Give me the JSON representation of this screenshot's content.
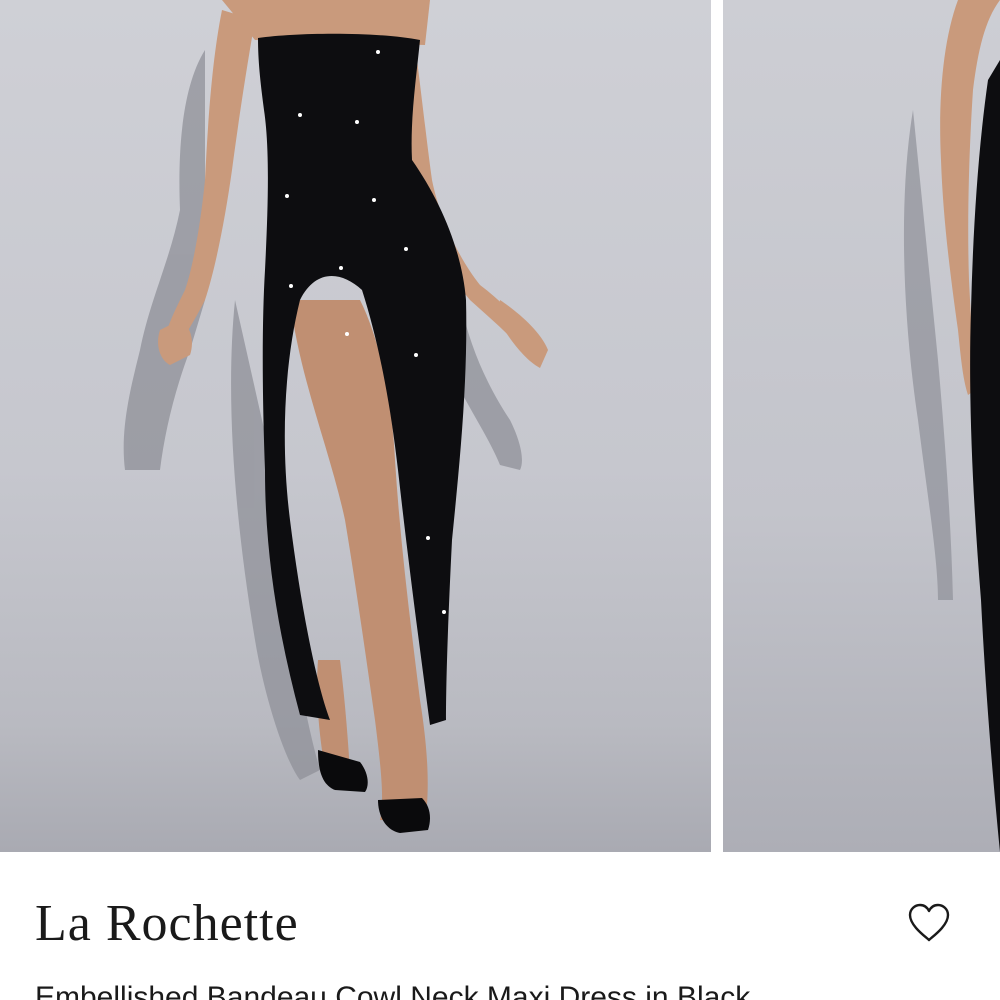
{
  "product": {
    "brand": "La Rochette",
    "name": "Embellished Bandeau Cowl Neck Maxi Dress in Black"
  },
  "gallery": {
    "images": [
      "dress-front-photo",
      "dress-back-photo"
    ]
  },
  "icons": {
    "wishlist": "heart-outline-icon"
  },
  "colors": {
    "text": "#1a1a1a",
    "background": "#ffffff",
    "dress": "#0d0d10"
  }
}
